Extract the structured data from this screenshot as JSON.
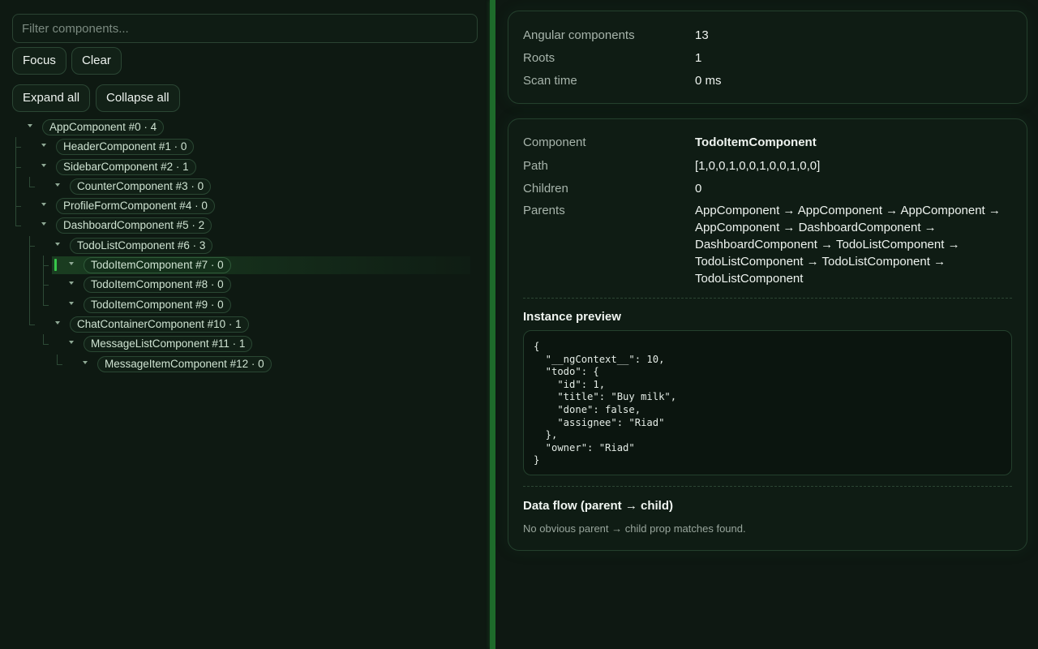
{
  "filter": {
    "placeholder": "Filter components..."
  },
  "buttons": {
    "focus": "Focus",
    "clear": "Clear",
    "expand_all": "Expand all",
    "collapse_all": "Collapse all"
  },
  "tree": [
    {
      "label": "AppComponent #0 · 4",
      "depth": 0,
      "selected": false
    },
    {
      "label": "HeaderComponent #1 · 0",
      "depth": 1,
      "selected": false
    },
    {
      "label": "SidebarComponent #2 · 1",
      "depth": 1,
      "selected": false
    },
    {
      "label": "CounterComponent #3 · 0",
      "depth": 2,
      "selected": false
    },
    {
      "label": "ProfileFormComponent #4 · 0",
      "depth": 1,
      "selected": false
    },
    {
      "label": "DashboardComponent #5 · 2",
      "depth": 1,
      "selected": false
    },
    {
      "label": "TodoListComponent #6 · 3",
      "depth": 2,
      "selected": false
    },
    {
      "label": "TodoItemComponent #7 · 0",
      "depth": 3,
      "selected": true
    },
    {
      "label": "TodoItemComponent #8 · 0",
      "depth": 3,
      "selected": false
    },
    {
      "label": "TodoItemComponent #9 · 0",
      "depth": 3,
      "selected": false
    },
    {
      "label": "ChatContainerComponent #10 · 1",
      "depth": 2,
      "selected": false
    },
    {
      "label": "MessageListComponent #11 · 1",
      "depth": 3,
      "selected": false
    },
    {
      "label": "MessageItemComponent #12 · 0",
      "depth": 4,
      "selected": false
    }
  ],
  "stats": {
    "components_label": "Angular components",
    "components_value": "13",
    "roots_label": "Roots",
    "roots_value": "1",
    "scan_label": "Scan time",
    "scan_value": "0 ms"
  },
  "detail": {
    "component_label": "Component",
    "component_value": "TodoItemComponent",
    "path_label": "Path",
    "path_value": "[1,0,0,1,0,0,1,0,0,1,0,0]",
    "children_label": "Children",
    "children_value": "0",
    "parents_label": "Parents",
    "parents_value": "AppComponent → AppComponent → AppComponent → AppComponent → DashboardComponent → DashboardComponent → TodoListComponent → TodoListComponent → TodoListComponent → TodoListComponent",
    "instance_title": "Instance preview",
    "instance_json": "{\n  \"__ngContext__\": 10,\n  \"todo\": {\n    \"id\": 1,\n    \"title\": \"Buy milk\",\n    \"done\": false,\n    \"assignee\": \"Riad\"\n  },\n  \"owner\": \"Riad\"\n}",
    "dataflow_title": "Data flow (parent → child)",
    "dataflow_text": "No obvious parent → child prop matches found."
  },
  "colors": {
    "accent": "#1e6b2b",
    "selection": "#37c84a",
    "background": "#0f1a13"
  }
}
